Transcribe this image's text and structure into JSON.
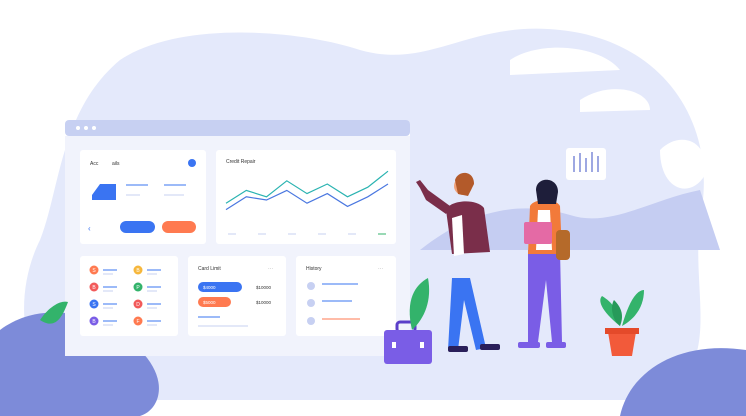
{
  "colors": {
    "blob": "#e4e9fb",
    "blob_dark": "#c5cdf2",
    "dark_blue": "#7d8bd9",
    "panel_bar": "#c7d0f2",
    "accent_blue": "#3a74f2",
    "accent_orange": "#ff7a50",
    "line_teal": "#2ab3b1",
    "line_blue": "#4a77e0",
    "plant_green": "#33b36b",
    "suitcase": "#7a5de6"
  },
  "accounts_card": {
    "title_left": "Acc",
    "title_right": "ails",
    "back_arrow": "‹"
  },
  "credit_repair_card": {
    "title": "Credit Repair",
    "series_teal": [
      8,
      16,
      12,
      22,
      14,
      20,
      12,
      18,
      28
    ],
    "series_blue": [
      4,
      12,
      10,
      16,
      8,
      14,
      6,
      12,
      20
    ]
  },
  "avatar_card": {
    "items_left": [
      {
        "letter": "S",
        "color": "#ff7a50"
      },
      {
        "letter": "B",
        "color": "#f25a5a"
      },
      {
        "letter": "S",
        "color": "#3a74f2"
      },
      {
        "letter": "B",
        "color": "#7a5de6"
      }
    ],
    "items_right": [
      {
        "letter": "B",
        "color": "#f6b73c"
      },
      {
        "letter": "P",
        "color": "#33b36b"
      },
      {
        "letter": "D",
        "color": "#f25a5a"
      },
      {
        "letter": "F",
        "color": "#ff7a50"
      }
    ]
  },
  "card_limit_card": {
    "title": "Card Limit",
    "menu": "···",
    "rows": [
      {
        "value": "$4000",
        "limit": "$10000",
        "color": "#3a74f2"
      },
      {
        "value": "$5000",
        "limit": "$10000",
        "color": "#ff7a50"
      }
    ]
  },
  "history_card": {
    "title": "History",
    "menu": "···"
  }
}
